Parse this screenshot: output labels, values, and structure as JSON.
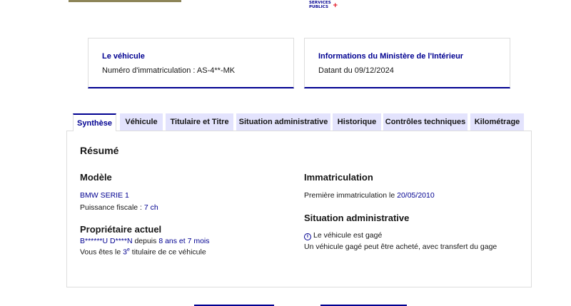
{
  "logo": {
    "line1": "SERVICES",
    "line2": "PUBLICS",
    "plus": "+"
  },
  "cards": {
    "vehicle": {
      "title": "Le véhicule",
      "text": "Numéro d'immatriculation : AS-4**-MK"
    },
    "ministry": {
      "title": "Informations du Ministère de l'Intérieur",
      "text": "Datant du 09/12/2024"
    }
  },
  "tabs": [
    {
      "label": "Synthèse"
    },
    {
      "label": "Véhicule"
    },
    {
      "label": "Titulaire et Titre"
    },
    {
      "label": "Situation administrative"
    },
    {
      "label": "Historique"
    },
    {
      "label": "Contrôles techniques"
    },
    {
      "label": "Kilométrage"
    }
  ],
  "summary": {
    "heading": "Résumé",
    "model": {
      "heading": "Modèle",
      "name": "BMW SERIE 1",
      "power_label": "Puissance fiscale : ",
      "power_value": "7 ch"
    },
    "owner": {
      "heading": "Propriétaire actuel",
      "name": "B******U D****N",
      "since_label": " depuis ",
      "since_value": "8 ans et 7 mois",
      "rank_prefix": "Vous êtes le ",
      "rank_value": "3",
      "rank_sup": "e",
      "rank_suffix": " titulaire de ce véhicule"
    },
    "registration": {
      "heading": "Immatriculation",
      "first_label": "Première immatriculation le ",
      "first_value": "20/05/2010"
    },
    "admin": {
      "heading": "Situation administrative",
      "status": "Le véhicule est gagé",
      "note": "Un véhicule gagé peut être acheté, avec transfert du gage"
    }
  }
}
